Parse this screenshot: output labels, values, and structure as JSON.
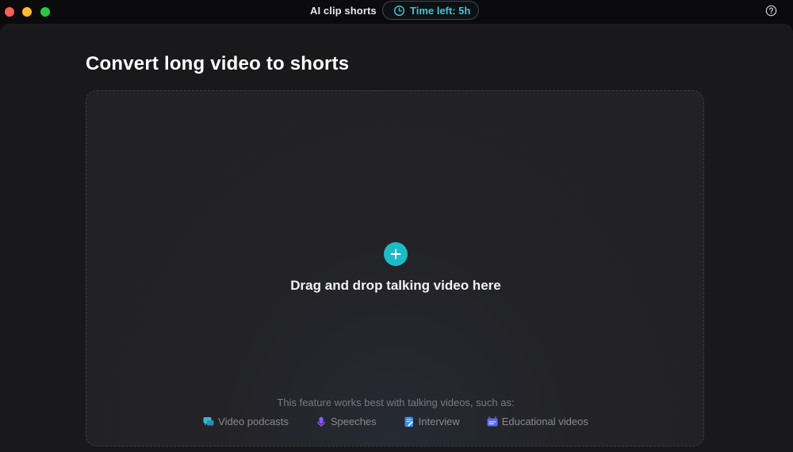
{
  "window": {
    "app_title": "AI clip shorts",
    "time_left": "Time left: 5h"
  },
  "main": {
    "title": "Convert long video to shorts",
    "dropzone": {
      "prompt": "Drag and drop talking video here",
      "hint": "This feature works best with talking videos, such as:",
      "examples": [
        {
          "label": "Video podcasts",
          "icon": "chat-bubble-icon",
          "color": "#35b8d8"
        },
        {
          "label": "Speeches",
          "icon": "microphone-icon",
          "color": "#8a5cf0"
        },
        {
          "label": "Interview",
          "icon": "document-edit-icon",
          "color": "#3a8de8"
        },
        {
          "label": "Educational videos",
          "icon": "board-icon",
          "color": "#5a6ae8"
        }
      ]
    }
  },
  "colors": {
    "accent": "#1dbbc8",
    "time_text": "#3fc3d6"
  }
}
